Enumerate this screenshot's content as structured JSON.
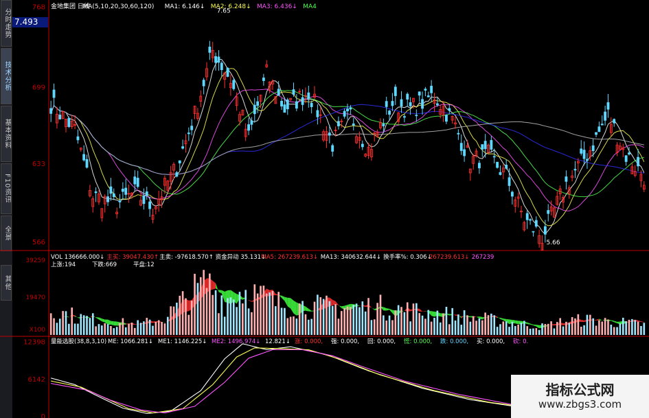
{
  "sidebar": {
    "tabs": [
      {
        "label": "分时走势",
        "active": false
      },
      {
        "label": "技术分析",
        "active": true
      },
      {
        "label": "基本资料",
        "active": false
      },
      {
        "label": "F10资讯",
        "active": false
      },
      {
        "label": "全景",
        "active": false
      },
      {
        "label": "其他",
        "active": false
      }
    ]
  },
  "price_box": "7.493",
  "watermark": {
    "title": "指标公式网",
    "url": "www.zbgs3.com"
  },
  "colors": {
    "up": "#ff3030",
    "down": "#5fd7ff",
    "ma1": "#ffffff",
    "ma2": "#ffff55",
    "ma3": "#ff55ff",
    "ma4": "#55ff55",
    "ma5": "#3030ff",
    "ma6": "#c0c0c0",
    "axis": "#c00000",
    "fill_green": "#40ff40",
    "fill_red": "#ff3030"
  },
  "chart_data": [
    {
      "type": "candlestick",
      "title": "金地集团 日线",
      "legend_text": [
        {
          "text": "金地集团 日线",
          "color": "#ffffff"
        },
        {
          "text": "MA(5,10,20,30,60,120)",
          "color": "#ffffff"
        },
        {
          "text": "MA1: 6.146↓",
          "color": "#ffffff"
        },
        {
          "text": "MA2: 6.248↓",
          "color": "#ffff55"
        },
        {
          "text": "MA3: 6.436↓",
          "color": "#ff55ff"
        },
        {
          "text": "MA4",
          "color": "#55ff55"
        }
      ],
      "y_ticks": [
        {
          "label": "768",
          "value": 7.68
        },
        {
          "label": "699",
          "value": 6.99
        },
        {
          "label": "633",
          "value": 6.33
        },
        {
          "label": "566",
          "value": 5.66
        }
      ],
      "ylim": [
        5.6,
        7.7
      ],
      "annotations": [
        {
          "text": "7.65",
          "value": 7.65
        },
        {
          "text": "5.66",
          "value": 5.66
        }
      ],
      "anchors": [
        {
          "i": 0,
          "v": 6.85
        },
        {
          "i": 8,
          "v": 6.62
        },
        {
          "i": 14,
          "v": 6.05
        },
        {
          "i": 22,
          "v": 5.98
        },
        {
          "i": 28,
          "v": 6.08
        },
        {
          "i": 34,
          "v": 5.95
        },
        {
          "i": 42,
          "v": 6.3
        },
        {
          "i": 48,
          "v": 6.75
        },
        {
          "i": 54,
          "v": 7.3
        },
        {
          "i": 60,
          "v": 7.05
        },
        {
          "i": 66,
          "v": 6.55
        },
        {
          "i": 72,
          "v": 7.1
        },
        {
          "i": 78,
          "v": 6.8
        },
        {
          "i": 86,
          "v": 6.95
        },
        {
          "i": 94,
          "v": 6.5
        },
        {
          "i": 100,
          "v": 6.75
        },
        {
          "i": 106,
          "v": 6.45
        },
        {
          "i": 114,
          "v": 6.85
        },
        {
          "i": 120,
          "v": 6.8
        },
        {
          "i": 128,
          "v": 6.92
        },
        {
          "i": 134,
          "v": 6.7
        },
        {
          "i": 140,
          "v": 6.35
        },
        {
          "i": 146,
          "v": 6.4
        },
        {
          "i": 152,
          "v": 6.22
        },
        {
          "i": 158,
          "v": 5.85
        },
        {
          "i": 164,
          "v": 5.7
        },
        {
          "i": 172,
          "v": 6.15
        },
        {
          "i": 180,
          "v": 6.45
        },
        {
          "i": 186,
          "v": 6.75
        },
        {
          "i": 192,
          "v": 6.4
        },
        {
          "i": 198,
          "v": 6.22
        }
      ],
      "candle_count": 199
    },
    {
      "type": "bar",
      "title": "VOL",
      "legend_text": [
        {
          "text": "VOL 136666.000↓",
          "color": "#ffffff"
        },
        {
          "text": "主买: 39047.430↑",
          "color": "#ff3030"
        },
        {
          "text": "主卖: -97618.570↑",
          "color": "#ffffff"
        },
        {
          "text": "资金异动 35.131↓",
          "color": "#ffffff"
        },
        {
          "text": "MA5: 267239.613↓",
          "color": "#ff3030"
        },
        {
          "text": "MA13: 340632.644↓",
          "color": "#ffffff"
        },
        {
          "text": "换手率%: 0.306↓",
          "color": "#ffffff"
        },
        {
          "text": "267239.613↓",
          "color": "#ff3030"
        },
        {
          "text": "267239",
          "color": "#ff55ff"
        }
      ],
      "sub_labels": [
        {
          "text": "上涨:194",
          "color": "#ffffff"
        },
        {
          "text": "下跌:669",
          "color": "#ffffff"
        },
        {
          "text": "平盘:12",
          "color": "#ffffff"
        }
      ],
      "y_ticks": [
        {
          "label": "39259"
        },
        {
          "label": "19470"
        },
        {
          "label": "X100"
        }
      ],
      "anchors": [
        {
          "i": 0,
          "v": 0.35
        },
        {
          "i": 10,
          "v": 0.25
        },
        {
          "i": 20,
          "v": 0.18
        },
        {
          "i": 30,
          "v": 0.15
        },
        {
          "i": 38,
          "v": 0.25
        },
        {
          "i": 46,
          "v": 0.55
        },
        {
          "i": 52,
          "v": 0.75
        },
        {
          "i": 58,
          "v": 0.5
        },
        {
          "i": 64,
          "v": 0.65
        },
        {
          "i": 70,
          "v": 0.55
        },
        {
          "i": 76,
          "v": 0.45
        },
        {
          "i": 90,
          "v": 0.4
        },
        {
          "i": 110,
          "v": 0.4
        },
        {
          "i": 130,
          "v": 0.3
        },
        {
          "i": 150,
          "v": 0.2
        },
        {
          "i": 164,
          "v": 0.12
        },
        {
          "i": 172,
          "v": 0.2
        },
        {
          "i": 180,
          "v": 0.22
        },
        {
          "i": 190,
          "v": 0.18
        },
        {
          "i": 198,
          "v": 0.15
        }
      ]
    },
    {
      "type": "line",
      "title": "量能选股",
      "legend_text": [
        {
          "text": "量能选股(38,8,3,10)",
          "color": "#ffffff"
        },
        {
          "text": "ME: 1066.281↓",
          "color": "#ffffff"
        },
        {
          "text": "ME1: 1146.225↓",
          "color": "#ffffff"
        },
        {
          "text": "ME2: 1496.974↓",
          "color": "#ff55ff"
        },
        {
          "text": "12.821↓",
          "color": "#ffffff"
        },
        {
          "text": "涨: 0.000,",
          "color": "#ff3030"
        },
        {
          "text": "强: 0.000,",
          "color": "#ffffff"
        },
        {
          "text": "回: 0.000,",
          "color": "#ffffff"
        },
        {
          "text": "慌: 0.000,",
          "color": "#55ff55"
        },
        {
          "text": "跌: 0.000,",
          "color": "#5fd7ff"
        },
        {
          "text": "买: 0.000,",
          "color": "#ffffff"
        },
        {
          "text": "砍: 0.",
          "color": "#ff55ff"
        }
      ],
      "y_ticks": [
        {
          "label": "12398",
          "value": 12398
        },
        {
          "label": "6142",
          "value": 6142
        },
        {
          "label": "0",
          "value": 0
        }
      ],
      "ylim": [
        0,
        13000
      ],
      "series": [
        {
          "anchors": [
            {
              "i": 0,
              "v": 6300
            },
            {
              "i": 8,
              "v": 5200
            },
            {
              "i": 16,
              "v": 3200
            },
            {
              "i": 24,
              "v": 1300
            },
            {
              "i": 32,
              "v": 400
            },
            {
              "i": 40,
              "v": 800
            },
            {
              "i": 50,
              "v": 4200
            },
            {
              "i": 58,
              "v": 9500
            },
            {
              "i": 64,
              "v": 12000
            },
            {
              "i": 72,
              "v": 11000
            },
            {
              "i": 80,
              "v": 11500
            },
            {
              "i": 92,
              "v": 10200
            },
            {
              "i": 106,
              "v": 7500
            },
            {
              "i": 124,
              "v": 4600
            },
            {
              "i": 140,
              "v": 2700
            },
            {
              "i": 160,
              "v": 1200
            },
            {
              "i": 180,
              "v": 400
            },
            {
              "i": 198,
              "v": 200
            }
          ]
        },
        {
          "anchors": [
            {
              "i": 0,
              "v": 5800
            },
            {
              "i": 10,
              "v": 4800
            },
            {
              "i": 18,
              "v": 3000
            },
            {
              "i": 26,
              "v": 1200
            },
            {
              "i": 34,
              "v": 500
            },
            {
              "i": 44,
              "v": 1200
            },
            {
              "i": 54,
              "v": 5200
            },
            {
              "i": 62,
              "v": 9800
            },
            {
              "i": 68,
              "v": 11300
            },
            {
              "i": 76,
              "v": 11200
            },
            {
              "i": 86,
              "v": 11000
            },
            {
              "i": 96,
              "v": 9500
            },
            {
              "i": 110,
              "v": 6800
            },
            {
              "i": 128,
              "v": 4200
            },
            {
              "i": 146,
              "v": 2300
            },
            {
              "i": 166,
              "v": 1000
            },
            {
              "i": 186,
              "v": 350
            },
            {
              "i": 198,
              "v": 250
            }
          ]
        },
        {
          "anchors": [
            {
              "i": 0,
              "v": 5400
            },
            {
              "i": 12,
              "v": 4300
            },
            {
              "i": 20,
              "v": 2600
            },
            {
              "i": 30,
              "v": 1000
            },
            {
              "i": 38,
              "v": 500
            },
            {
              "i": 48,
              "v": 1600
            },
            {
              "i": 58,
              "v": 5600
            },
            {
              "i": 66,
              "v": 9600
            },
            {
              "i": 74,
              "v": 11000
            },
            {
              "i": 84,
              "v": 11000
            },
            {
              "i": 94,
              "v": 10000
            },
            {
              "i": 104,
              "v": 8200
            },
            {
              "i": 118,
              "v": 5800
            },
            {
              "i": 136,
              "v": 3600
            },
            {
              "i": 154,
              "v": 1900
            },
            {
              "i": 174,
              "v": 800
            },
            {
              "i": 198,
              "v": 300
            }
          ]
        }
      ]
    }
  ]
}
